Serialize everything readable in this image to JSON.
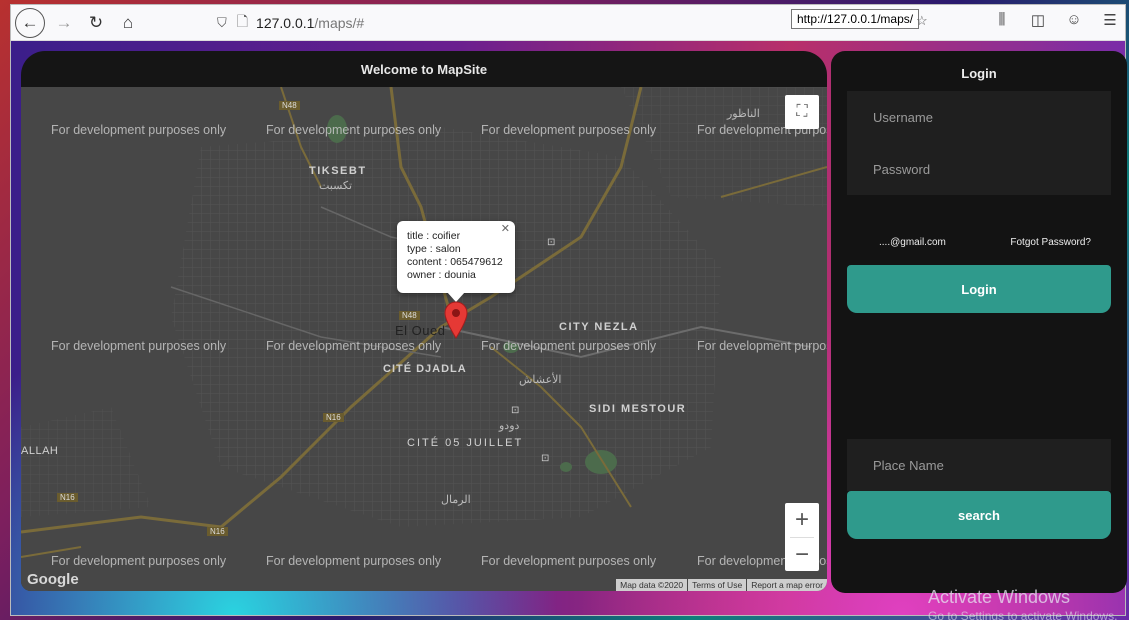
{
  "browser": {
    "url_host": "127.0.0.1",
    "url_path": "/maps/#",
    "tooltip": "http://127.0.0.1/maps/"
  },
  "map": {
    "title": "Welcome to MapSite",
    "dev_watermark": "For development purposes only",
    "places": {
      "tiksebt": "TIKSEBT",
      "tiksebt_ar": "تكسبت",
      "el_oued": "El Oued",
      "city_nezla": "CITY NEZLA",
      "cite_djadla": "CITÉ DJADLA",
      "sidi_mestour": "SIDI MESTOUR",
      "cite_05": "CITÉ 05 JUILLET",
      "allah": "ALLAH",
      "alnatour": "الناظور",
      "alacassas": "الأعشاش",
      "dudu": "دودو",
      "rimal": "الرمال"
    },
    "road_labels": [
      "N48",
      "N48",
      "N16",
      "N16",
      "N16"
    ],
    "info": {
      "title": "title : coifier",
      "type": "type : salon",
      "content": "content : 065479612",
      "owner": "owner : dounia"
    },
    "zoom_in": "+",
    "zoom_out": "−",
    "google": "Google",
    "attribution": [
      "Map data ©2020",
      "Terms of Use",
      "Report a map error"
    ]
  },
  "login": {
    "title": "Login",
    "username_placeholder": "Username",
    "password_placeholder": "Password",
    "email_hint": "....@gmail.com",
    "forgot": "Fotgot Password?",
    "login_button": "Login",
    "place_placeholder": "Place Name",
    "search_button": "search"
  },
  "os": {
    "activate": "Activate Windows",
    "activate_sub": "Go to Settings to activate Windows."
  },
  "colors": {
    "teal": "#2f9a8c",
    "panel": "#131313",
    "marker": "#e53935"
  }
}
